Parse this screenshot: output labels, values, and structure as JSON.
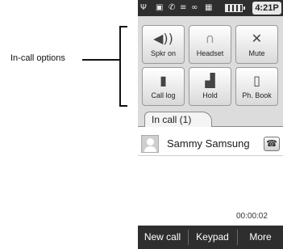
{
  "annotation": {
    "label": "In-call options"
  },
  "status_bar": {
    "icons": [
      "signal-icon",
      "message-icon",
      "call-icon",
      "bluetooth-icon",
      "voicemail-icon",
      "network-icon",
      "battery-icon"
    ],
    "time": "4:21P"
  },
  "options": [
    {
      "label": "Spkr on",
      "icon": "speaker-icon"
    },
    {
      "label": "Headset",
      "icon": "headset-icon"
    },
    {
      "label": "Mute",
      "icon": "mute-icon"
    },
    {
      "label": "Call log",
      "icon": "call-log-icon"
    },
    {
      "label": "Hold",
      "icon": "hold-icon"
    },
    {
      "label": "Ph. Book",
      "icon": "phonebook-icon"
    }
  ],
  "tab": {
    "label": "In call (1)"
  },
  "call": {
    "caller_name": "Sammy Samsung",
    "duration": "00:00:02"
  },
  "bottom_bar": {
    "new_call": "New call",
    "keypad": "Keypad",
    "more": "More"
  }
}
